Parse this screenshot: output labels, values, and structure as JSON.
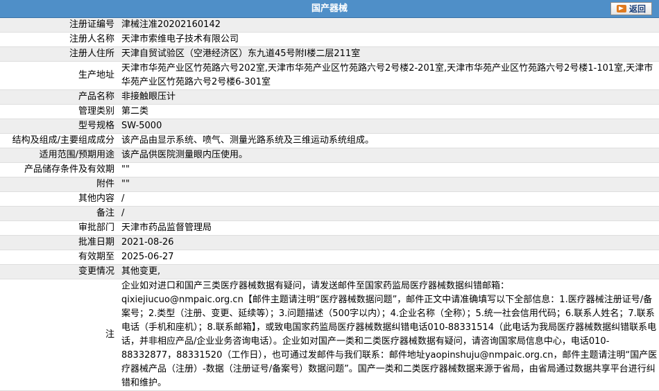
{
  "header": {
    "title": "国产器械",
    "back_label": "返回"
  },
  "fields": [
    {
      "label": "注册证编号",
      "value": "津械注准20202160142"
    },
    {
      "label": "注册人名称",
      "value": "天津市索维电子技术有限公司"
    },
    {
      "label": "注册人住所",
      "value": "天津自贸试验区（空港经济区）东九道45号附Ⅰ楼二层211室"
    },
    {
      "label": "生产地址",
      "value": "天津市华苑产业区竹苑路六号202室,天津市华苑产业区竹苑路六号2号楼2-201室,天津市华苑产业区竹苑路六号2号楼1-101室,天津市华苑产业区竹苑路六号2号楼6-301室"
    },
    {
      "label": "产品名称",
      "value": "非接触眼压计"
    },
    {
      "label": "管理类别",
      "value": "第二类"
    },
    {
      "label": "型号规格",
      "value": "SW-5000"
    },
    {
      "label": "结构及组成/主要组成成分",
      "value": "该产品由显示系统、喷气、测量光路系统及三维运动系统组成。"
    },
    {
      "label": "适用范围/预期用途",
      "value": "该产品供医院测量眼内压使用。"
    },
    {
      "label": "产品储存条件及有效期",
      "value": "\"\""
    },
    {
      "label": "附件",
      "value": "\"\""
    },
    {
      "label": "其他内容",
      "value": "/"
    },
    {
      "label": "备注",
      "value": "/"
    },
    {
      "label": "审批部门",
      "value": "天津市药品监督管理局"
    },
    {
      "label": "批准日期",
      "value": "2021-08-26"
    },
    {
      "label": "有效期至",
      "value": "2025-06-27"
    },
    {
      "label": "变更情况",
      "value": "其他变更,"
    }
  ],
  "note": {
    "label": "注",
    "intro": "企业如对进口和国产三类医疗器械数据有疑问，请发送邮件至国家药监局医疗器械数据纠错邮箱：",
    "email1": "qixiejiucuo@nmpaic.org.cn",
    "text1": "【邮件主题请注明“医疗器械数据问题”，邮件正文中请准确填写以下全部信息：1.医疗器械注册证号/备案号；2.类型（注册、变更、延续等）；3.问题描述（500字以内）；4.企业名称（全称）；5.统一社会信用代码；6.联系人姓名；7.联系电话（手机和座机）；8.联系邮箱】，或致电国家药监局医疗器械数据纠错电话010-88331514（此电话为我局医疗器械数据纠错联系电话，并非相应产品/企业业务咨询电话）。企业如对国产一类和二类医疗器械数据有疑问，请咨询国家局信息中心，电话010-88332877，88331520（工作日），也可通过发邮件与我们联系：邮件地址",
    "email2": "yaopinshuju@nmpaic.org.cn",
    "text2": "，邮件主题请注明“国产医疗器械产品（注册）-数据（注册证号/备案号）数据问题”。国产一类和二类医疗器械数据来源于省局，由省局通过数据共享平台进行纠错和维护。"
  }
}
